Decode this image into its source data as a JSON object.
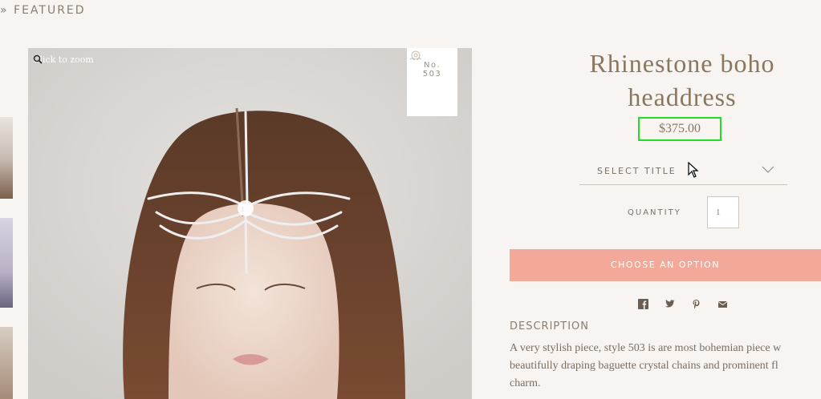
{
  "breadcrumb": {
    "text": "» FEATURED"
  },
  "gallery": {
    "zoom_hint": "Click to zoom",
    "badge_line1": "No.",
    "badge_line2": "503",
    "zoom_icon": "magnifier-icon",
    "badge_icon": "rose-icon"
  },
  "product": {
    "title": "Rhinestone boho headdress",
    "price": "$375.00",
    "select_label": "SELECT TITLE",
    "quantity_label": "QUANTITY",
    "quantity_value": "1",
    "cta_label": "CHOOSE AN OPTION",
    "share_icons": [
      "facebook-icon",
      "twitter-icon",
      "pinterest-icon",
      "email-icon"
    ]
  },
  "description": {
    "heading": "DESCRIPTION",
    "line1": "A very stylish piece, style 503 is are most bohemian piece w",
    "line2": "beautifully draping baguette crystal chains and prominent fl",
    "line3": "charm."
  },
  "colors": {
    "background": "#f7f4f2",
    "accent_button": "#f2a999",
    "title_text": "#8a7760",
    "highlight_box": "#22dd22"
  }
}
